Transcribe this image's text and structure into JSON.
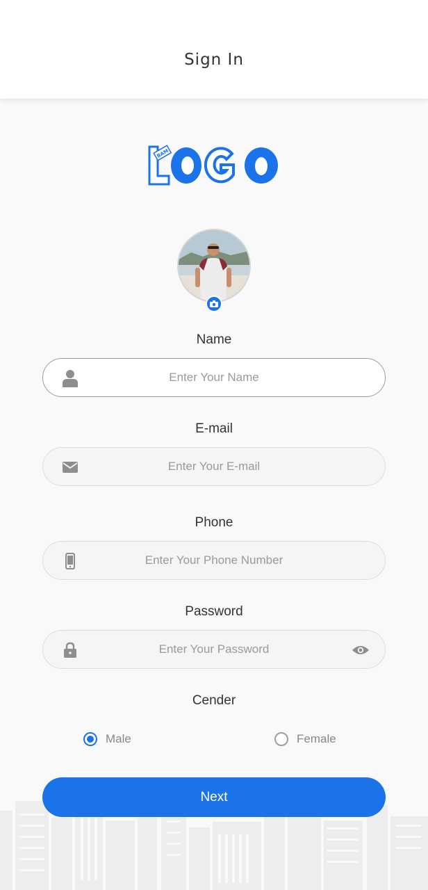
{
  "header": {
    "title": "Sign In"
  },
  "colors": {
    "accent": "#1a73e8",
    "background": "#f9f9f9",
    "placeholder": "#9a9a9a"
  },
  "form": {
    "name": {
      "label": "Name",
      "placeholder": "Enter Your Name",
      "value": "",
      "icon": "person-icon"
    },
    "email": {
      "label": "E-mail",
      "placeholder": "Enter Your E-mail",
      "value": "",
      "icon": "envelope-icon"
    },
    "phone": {
      "label": "Phone",
      "placeholder": "Enter Your Phone Number",
      "value": "",
      "icon": "phone-icon"
    },
    "password": {
      "label": "Password",
      "placeholder": "Enter Your Password",
      "value": "",
      "icon": "lock-icon",
      "toggle_icon": "eye-icon"
    },
    "gender": {
      "label": "Cender",
      "options": [
        {
          "label": "Male",
          "checked": true
        },
        {
          "label": "Female",
          "checked": false
        }
      ]
    }
  },
  "actions": {
    "next_label": "Next"
  }
}
